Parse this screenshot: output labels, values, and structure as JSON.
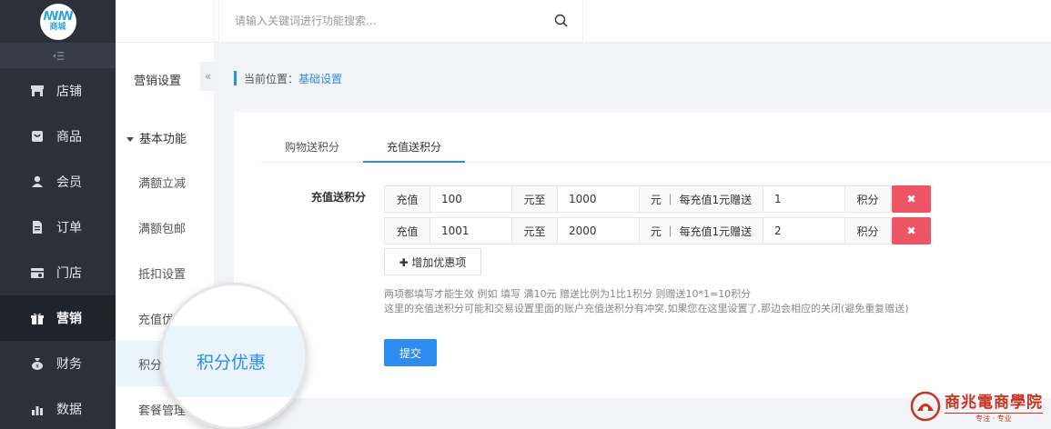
{
  "logo": {
    "mark": "ꟿꟿ",
    "text": "商城"
  },
  "sidebar": {
    "collapse_icon": "collapse-left-icon",
    "items": [
      {
        "label": "店铺",
        "icon": "store-icon"
      },
      {
        "label": "商品",
        "icon": "goods-icon"
      },
      {
        "label": "会员",
        "icon": "user-icon"
      },
      {
        "label": "订单",
        "icon": "order-icon"
      },
      {
        "label": "门店",
        "icon": "shop-icon"
      },
      {
        "label": "营销",
        "icon": "gift-icon",
        "active": true
      },
      {
        "label": "财务",
        "icon": "money-bag-icon"
      },
      {
        "label": "数据",
        "icon": "chart-icon"
      }
    ]
  },
  "subnav": {
    "title": "营销设置",
    "fold_glyph": "«",
    "group": "基本功能",
    "items": [
      {
        "label": "满额立减"
      },
      {
        "label": "满额包邮"
      },
      {
        "label": "抵扣设置"
      },
      {
        "label": "充值优"
      },
      {
        "label": "积分",
        "active": true
      },
      {
        "label": "套餐管理"
      }
    ]
  },
  "header": {
    "search_placeholder": "请输入关键词进行功能搜索..."
  },
  "breadcrumb": {
    "prefix": "当前位置：",
    "current": "基础设置"
  },
  "tabs": [
    {
      "label": "购物送积分"
    },
    {
      "label": "充值送积分",
      "active": true
    }
  ],
  "form": {
    "label": "充值送积分",
    "rules": [
      {
        "prefix": "充值",
        "from": "100",
        "to_label": "元至",
        "to": "1000",
        "per_label": "元 ｜ 每充值1元赠送",
        "points": "1",
        "unit": "积分",
        "delete": "✖"
      },
      {
        "prefix": "充值",
        "from": "1001",
        "to_label": "元至",
        "to": "2000",
        "per_label": "元 ｜ 每充值1元赠送",
        "points": "2",
        "unit": "积分",
        "delete": "✖"
      }
    ],
    "add_button": "✚ 增加优惠项",
    "help_lines": [
      "两项都填写才能生效 例如 填写 满10元 赠送比例为1比1积分 则赠送10*1=10积分",
      "这里的充值送积分可能和交易设置里面的账户充值送积分有冲突,如果您在这里设置了,那边会相应的关闭(避免重复赠送)"
    ],
    "submit": "提交"
  },
  "magnifier": {
    "text": "积分优惠"
  },
  "watermark": {
    "title": "商兆電商學院",
    "sub": "专注 · 专业"
  },
  "colors": {
    "accent": "#2d8cf0",
    "danger": "#ed5565",
    "sidebar": "#2b3039",
    "watermark": "#c8321f"
  }
}
